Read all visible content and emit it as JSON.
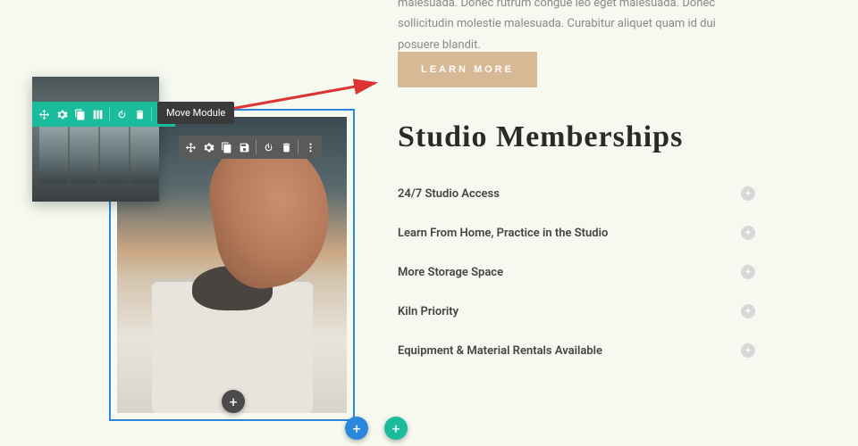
{
  "intro_text": "malesuada. Donec rutrum congue leo eget malesuada. Donec sollicitudin molestie malesuada. Curabitur aliquet quam id dui posuere blandit.",
  "learn_more": "LEARN MORE",
  "heading": "Studio Memberships",
  "accordion": [
    "24/7 Studio Access",
    "Learn From Home, Practice in the Studio",
    "More Storage Space",
    "Kiln Priority",
    "Equipment & Material Rentals Available"
  ],
  "tooltip": "Move Module",
  "toolbar_icons": {
    "move": "move-icon",
    "settings": "gear-icon",
    "duplicate": "duplicate-icon",
    "columns": "columns-icon",
    "save": "save-icon",
    "power": "power-icon",
    "delete": "trash-icon",
    "more": "more-icon"
  }
}
